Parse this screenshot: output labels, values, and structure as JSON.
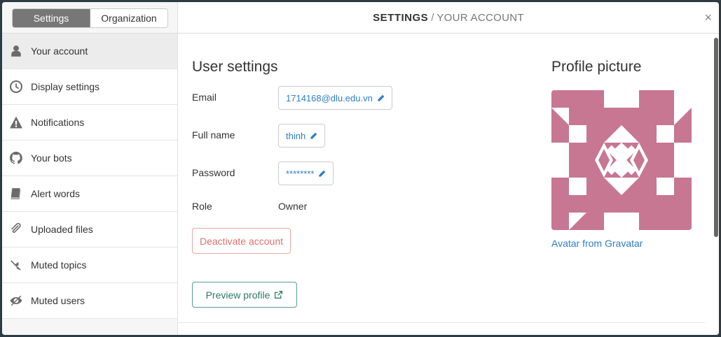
{
  "sidebar": {
    "toggle": {
      "settings_label": "Settings",
      "organization_label": "Organization"
    },
    "items": [
      {
        "label": "Your account",
        "icon": "user-icon"
      },
      {
        "label": "Display settings",
        "icon": "clock-icon"
      },
      {
        "label": "Notifications",
        "icon": "warning-icon"
      },
      {
        "label": "Your bots",
        "icon": "github-icon"
      },
      {
        "label": "Alert words",
        "icon": "book-icon"
      },
      {
        "label": "Uploaded files",
        "icon": "paperclip-icon"
      },
      {
        "label": "Muted topics",
        "icon": "mute-icon"
      },
      {
        "label": "Muted users",
        "icon": "eye-slash-icon"
      }
    ]
  },
  "header": {
    "title": "SETTINGS",
    "separator": "/",
    "subtitle": "YOUR ACCOUNT",
    "close": "×"
  },
  "user_settings": {
    "title": "User settings",
    "email_label": "Email",
    "email_value": "1714168@dlu.edu.vn",
    "fullname_label": "Full name",
    "fullname_value": "thinh",
    "password_label": "Password",
    "password_value": "********",
    "role_label": "Role",
    "role_value": "Owner",
    "deactivate_label": "Deactivate account",
    "preview_label": "Preview profile"
  },
  "profile_picture": {
    "title": "Profile picture",
    "gravatar_link": "Avatar from Gravatar",
    "avatar_color": "#c77791"
  }
}
